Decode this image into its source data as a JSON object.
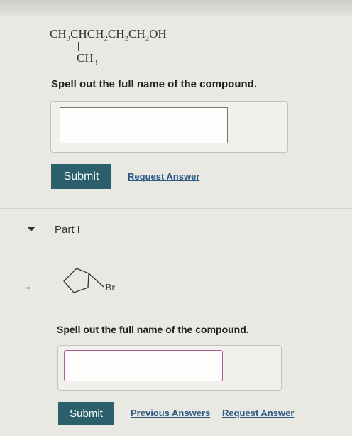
{
  "formula": {
    "ch3": "CH",
    "sub3": "3",
    "chain1": "CHCH",
    "sub2a": "2",
    "chain2": "CH",
    "sub2b": "2",
    "chain3": "CH",
    "sub2c": "2",
    "chain4": "OH",
    "branch": "CH",
    "branch_sub": "3"
  },
  "part_h": {
    "prompt": "Spell out the full name of the compound.",
    "answer_value": "",
    "submit_label": "Submit",
    "request_answer_label": "Request Answer"
  },
  "part_i": {
    "title": "Part I",
    "structure_label": "Br",
    "prompt": "Spell out the full name of the compound.",
    "answer_value": "",
    "submit_label": "Submit",
    "previous_answers_label": "Previous Answers",
    "request_answer_label": "Request Answer"
  },
  "colors": {
    "button": "#2c5f6c",
    "link": "#2c5a86",
    "focus_border": "#b15a9a"
  }
}
